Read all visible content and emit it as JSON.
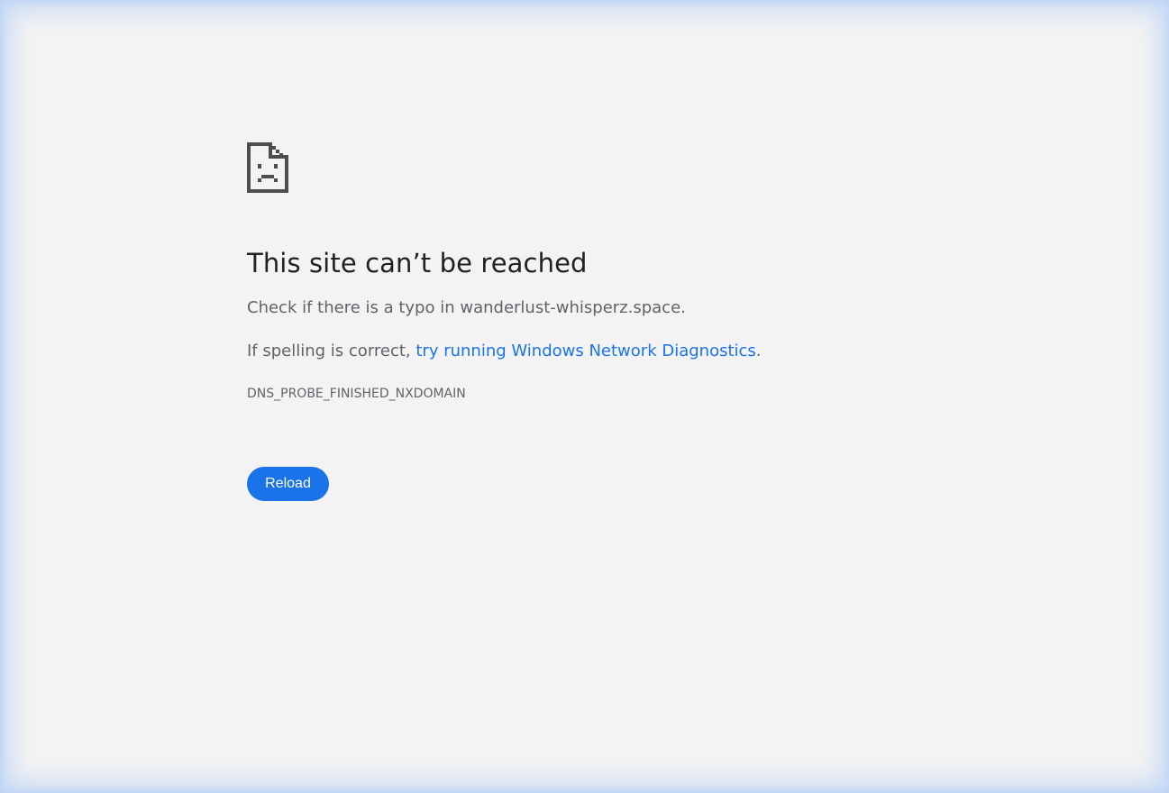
{
  "error_page": {
    "icon": "sad-document-icon",
    "title": "This site can’t be reached",
    "typo_prefix": "Check if there is a typo in ",
    "domain": "wanderlust-whisperz.space",
    "typo_suffix": ".",
    "spelling_prefix": "If spelling is correct, ",
    "diagnostics_link": "try running Windows Network Diagnostics",
    "spelling_suffix": ".",
    "error_code": "DNS_PROBE_FINISHED_NXDOMAIN",
    "reload_label": "Reload"
  },
  "colors": {
    "background": "#f3f3f3",
    "accent": "#1a73e8",
    "title": "#202124",
    "body_text": "#5f6368",
    "icon": "#4d4d4d"
  }
}
